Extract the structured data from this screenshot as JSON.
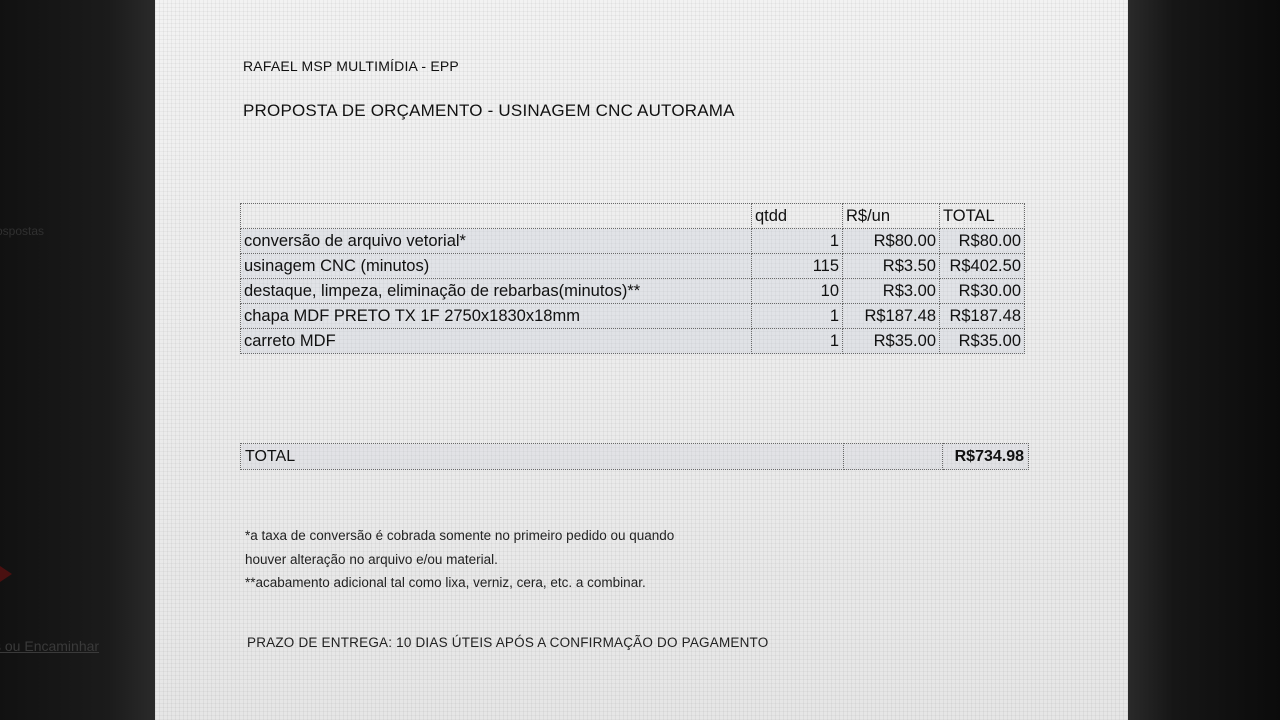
{
  "background_text": {
    "link_fragment": "s ou Encaminhar",
    "faint_fragment": "ospostas"
  },
  "document": {
    "company": "RAFAEL MSP MULTIMÍDIA - EPP",
    "title": "PROPOSTA DE ORÇAMENTO - USINAGEM CNC AUTORAMA",
    "table": {
      "headers": {
        "description": "",
        "qty": "qtdd",
        "unit_price": "R$/un",
        "total": "TOTAL"
      },
      "rows": [
        {
          "description": "conversão de arquivo vetorial*",
          "qty": "1",
          "unit_price": "R$80.00",
          "total": "R$80.00"
        },
        {
          "description": "usinagem CNC  (minutos)",
          "qty": "115",
          "unit_price": "R$3.50",
          "total": "R$402.50"
        },
        {
          "description": "destaque, limpeza, eliminação de rebarbas(minutos)**",
          "qty": "10",
          "unit_price": "R$3.00",
          "total": "R$30.00"
        },
        {
          "description": "chapa MDF PRETO TX 1F 2750x1830x18mm",
          "qty": "1",
          "unit_price": "R$187.48",
          "total": "R$187.48"
        },
        {
          "description": "carreto MDF",
          "qty": "1",
          "unit_price": "R$35.00",
          "total": "R$35.00"
        }
      ]
    },
    "grand_total": {
      "label": "TOTAL",
      "value": "R$734.98"
    },
    "notes": [
      "*a taxa de conversão é cobrada somente no primeiro pedido ou quando",
      "houver alteração no arquivo e/ou material.",
      "**acabamento adicional tal como lixa, verniz, cera, etc. a combinar."
    ],
    "delivery": "PRAZO DE ENTREGA: 10 DIAS ÚTEIS APÓS A CONFIRMAÇÃO DO PAGAMENTO"
  }
}
